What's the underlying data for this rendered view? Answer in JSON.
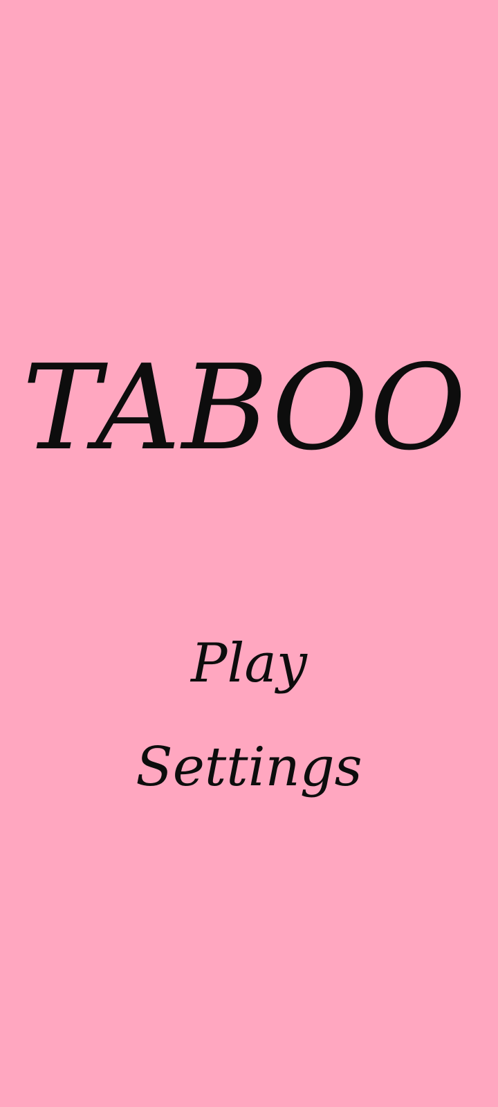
{
  "app": {
    "title": "TABOO"
  },
  "menu": {
    "play_label": "Play",
    "settings_label": "Settings"
  },
  "colors": {
    "background": "#ffa7c0",
    "text": "#0d0d0d"
  }
}
